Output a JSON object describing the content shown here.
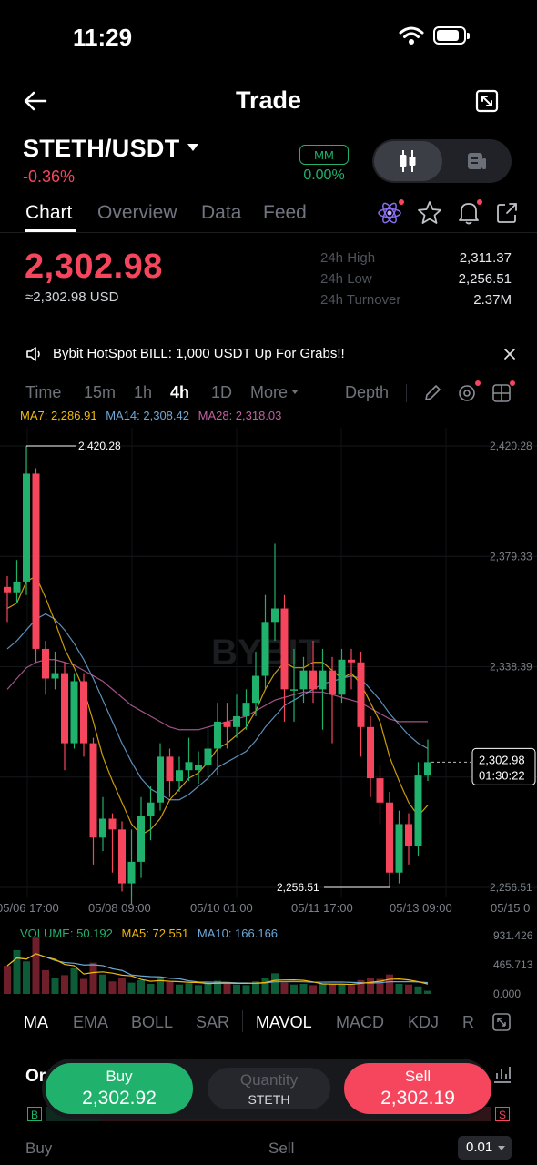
{
  "status": {
    "time": "11:29"
  },
  "nav": {
    "title": "Trade"
  },
  "pair": {
    "symbol": "STETH/USDT",
    "change": "-0.36%",
    "mm_label": "MM",
    "mm_value": "0.00%"
  },
  "tabs": [
    "Chart",
    "Overview",
    "Data",
    "Feed"
  ],
  "ticker": {
    "last_price": "2,302.98",
    "usd_price": "≈2,302.98 USD",
    "stats": [
      {
        "label": "24h High",
        "value": "2,311.37"
      },
      {
        "label": "24h Low",
        "value": "2,256.51"
      },
      {
        "label": "24h Turnover",
        "value": "2.37M"
      }
    ]
  },
  "announcement": {
    "text": "Bybit HotSpot BILL: 1,000 USDT Up For Grabs!!"
  },
  "intervals": {
    "items": [
      "Time",
      "15m",
      "1h",
      "4h",
      "1D",
      "More"
    ],
    "active": "4h",
    "depth_label": "Depth"
  },
  "ma_legend": [
    {
      "text": "MA7: 2,286.91",
      "color": "#f0b90b"
    },
    {
      "text": "MA14: 2,308.42",
      "color": "#6ea8d8"
    },
    {
      "text": "MA28: 2,318.03",
      "color": "#c060a1"
    }
  ],
  "chart_data": {
    "type": "candlestick",
    "y_axis_labels": [
      "2,420.28",
      "2,379.33",
      "2,338.39",
      "2,297.45",
      "2,256.51"
    ],
    "y_values": [
      2420.28,
      2379.33,
      2338.39,
      2297.45,
      2256.51
    ],
    "x_labels": [
      "05/06 17:00",
      "05/08 09:00",
      "05/10 01:00",
      "05/11 17:00",
      "05/13 09:00",
      "05/15 0"
    ],
    "high_marker": "2,420.28",
    "low_marker": "2,256.51",
    "current_price": "2,302.98",
    "countdown": "01:30:22",
    "ylim": [
      2256.51,
      2420.28
    ],
    "candles": [
      [
        2368,
        2366,
        2372,
        2355
      ],
      [
        2366,
        2370,
        2378,
        2362
      ],
      [
        2370,
        2410,
        2420.28,
        2365
      ],
      [
        2410,
        2345,
        2412,
        2340
      ],
      [
        2345,
        2334,
        2348,
        2328
      ],
      [
        2334,
        2336,
        2344,
        2330
      ],
      [
        2336,
        2310,
        2340,
        2300
      ],
      [
        2310,
        2333,
        2336,
        2308
      ],
      [
        2333,
        2310,
        2336,
        2305
      ],
      [
        2310,
        2275,
        2312,
        2265
      ],
      [
        2275,
        2282,
        2290,
        2270
      ],
      [
        2282,
        2278,
        2284,
        2262
      ],
      [
        2278,
        2258,
        2281,
        2255
      ],
      [
        2258,
        2266,
        2278,
        2250
      ],
      [
        2266,
        2283,
        2290,
        2260
      ],
      [
        2283,
        2288,
        2294,
        2274
      ],
      [
        2288,
        2305,
        2310,
        2285
      ],
      [
        2305,
        2296,
        2308,
        2290
      ],
      [
        2296,
        2300,
        2305,
        2292
      ],
      [
        2300,
        2303,
        2312,
        2296
      ],
      [
        2300,
        2302,
        2307,
        2295
      ],
      [
        2302,
        2308,
        2316,
        2296
      ],
      [
        2308,
        2318,
        2325,
        2298
      ],
      [
        2318,
        2316,
        2325,
        2308
      ],
      [
        2316,
        2320,
        2328,
        2312
      ],
      [
        2320,
        2325,
        2330,
        2315
      ],
      [
        2325,
        2335,
        2344,
        2320
      ],
      [
        2335,
        2355,
        2365,
        2330
      ],
      [
        2355,
        2360,
        2384,
        2348
      ],
      [
        2360,
        2330,
        2365,
        2318
      ],
      [
        2330,
        2330,
        2345,
        2318
      ],
      [
        2330,
        2337,
        2342,
        2325
      ],
      [
        2337,
        2330,
        2348,
        2325
      ],
      [
        2330,
        2337,
        2345,
        2315
      ],
      [
        2337,
        2328,
        2342,
        2310
      ],
      [
        2328,
        2341,
        2345,
        2325
      ],
      [
        2341,
        2340,
        2345,
        2330
      ],
      [
        2340,
        2316,
        2344,
        2305
      ],
      [
        2316,
        2297,
        2320,
        2290
      ],
      [
        2297,
        2288,
        2302,
        2280
      ],
      [
        2288,
        2262,
        2292,
        2256.51
      ],
      [
        2262,
        2280,
        2285,
        2258
      ],
      [
        2280,
        2272,
        2284,
        2265
      ],
      [
        2272,
        2298,
        2303,
        2268
      ],
      [
        2298,
        2302.98,
        2311.37,
        2296
      ]
    ],
    "ma7": [
      2360,
      2362,
      2370,
      2372,
      2364,
      2355,
      2345,
      2338,
      2330,
      2318,
      2305,
      2296,
      2288,
      2280,
      2276,
      2278,
      2282,
      2289,
      2293,
      2297,
      2299,
      2303,
      2308,
      2310,
      2313,
      2316,
      2322,
      2330,
      2336,
      2340,
      2338,
      2338,
      2340,
      2340,
      2337,
      2334,
      2336,
      2332,
      2325,
      2318,
      2305,
      2296,
      2288,
      2283,
      2287
    ],
    "ma14": [
      2345,
      2348,
      2352,
      2356,
      2358,
      2356,
      2352,
      2347,
      2341,
      2334,
      2326,
      2318,
      2310,
      2303,
      2297,
      2293,
      2291,
      2289,
      2289,
      2291,
      2294,
      2297,
      2301,
      2303,
      2305,
      2307,
      2311,
      2316,
      2320,
      2324,
      2326,
      2328,
      2330,
      2332,
      2333,
      2334,
      2335,
      2334,
      2330,
      2326,
      2321,
      2317,
      2313,
      2310,
      2308
    ],
    "ma28": [
      2330,
      2334,
      2338,
      2340,
      2341,
      2341,
      2340,
      2339,
      2337,
      2335,
      2333,
      2330,
      2327,
      2324,
      2322,
      2320,
      2318,
      2316,
      2315,
      2315,
      2315,
      2316,
      2317,
      2318,
      2319,
      2320,
      2322,
      2324,
      2326,
      2327,
      2328,
      2329,
      2329,
      2329,
      2328,
      2327,
      2326,
      2325,
      2323,
      2321,
      2319,
      2318,
      2318,
      2318,
      2318
    ],
    "volume": {
      "legend": [
        {
          "text": "VOLUME: 50.192",
          "color": "#20b26c"
        },
        {
          "text": "MA5: 72.551",
          "color": "#f0b90b"
        },
        {
          "text": "MA10: 166.166",
          "color": "#6ea8d8"
        }
      ],
      "y_axis_labels": [
        "931.426",
        "465.713",
        "0.000"
      ],
      "ylim": [
        0,
        931.426
      ],
      "values": [
        450,
        700,
        520,
        900,
        380,
        260,
        300,
        410,
        240,
        500,
        310,
        200,
        250,
        180,
        220,
        160,
        260,
        190,
        150,
        170,
        140,
        180,
        210,
        160,
        150,
        140,
        200,
        260,
        330,
        180,
        150,
        160,
        140,
        170,
        160,
        150,
        140,
        220,
        260,
        240,
        310,
        160,
        150,
        120,
        50.192
      ]
    }
  },
  "indicators": {
    "items": [
      "MA",
      "EMA",
      "BOLL",
      "SAR",
      "MAVOL",
      "MACD",
      "KDJ",
      "R"
    ],
    "active": [
      "MA",
      "MAVOL"
    ]
  },
  "orderbar": {
    "buy_label": "Buy",
    "buy_price": "2,302.92",
    "qty_placeholder": "Quantity",
    "qty_unit": "STETH",
    "sell_label": "Sell",
    "sell_price": "2,302.19",
    "or_stub": "Or"
  },
  "book_footer": {
    "buy": "Buy",
    "sell": "Sell",
    "precision": "0.01",
    "b_badge": "B",
    "s_badge": "S"
  },
  "colors": {
    "up": "#20b26c",
    "down": "#f6465d",
    "bg": "#000000"
  }
}
